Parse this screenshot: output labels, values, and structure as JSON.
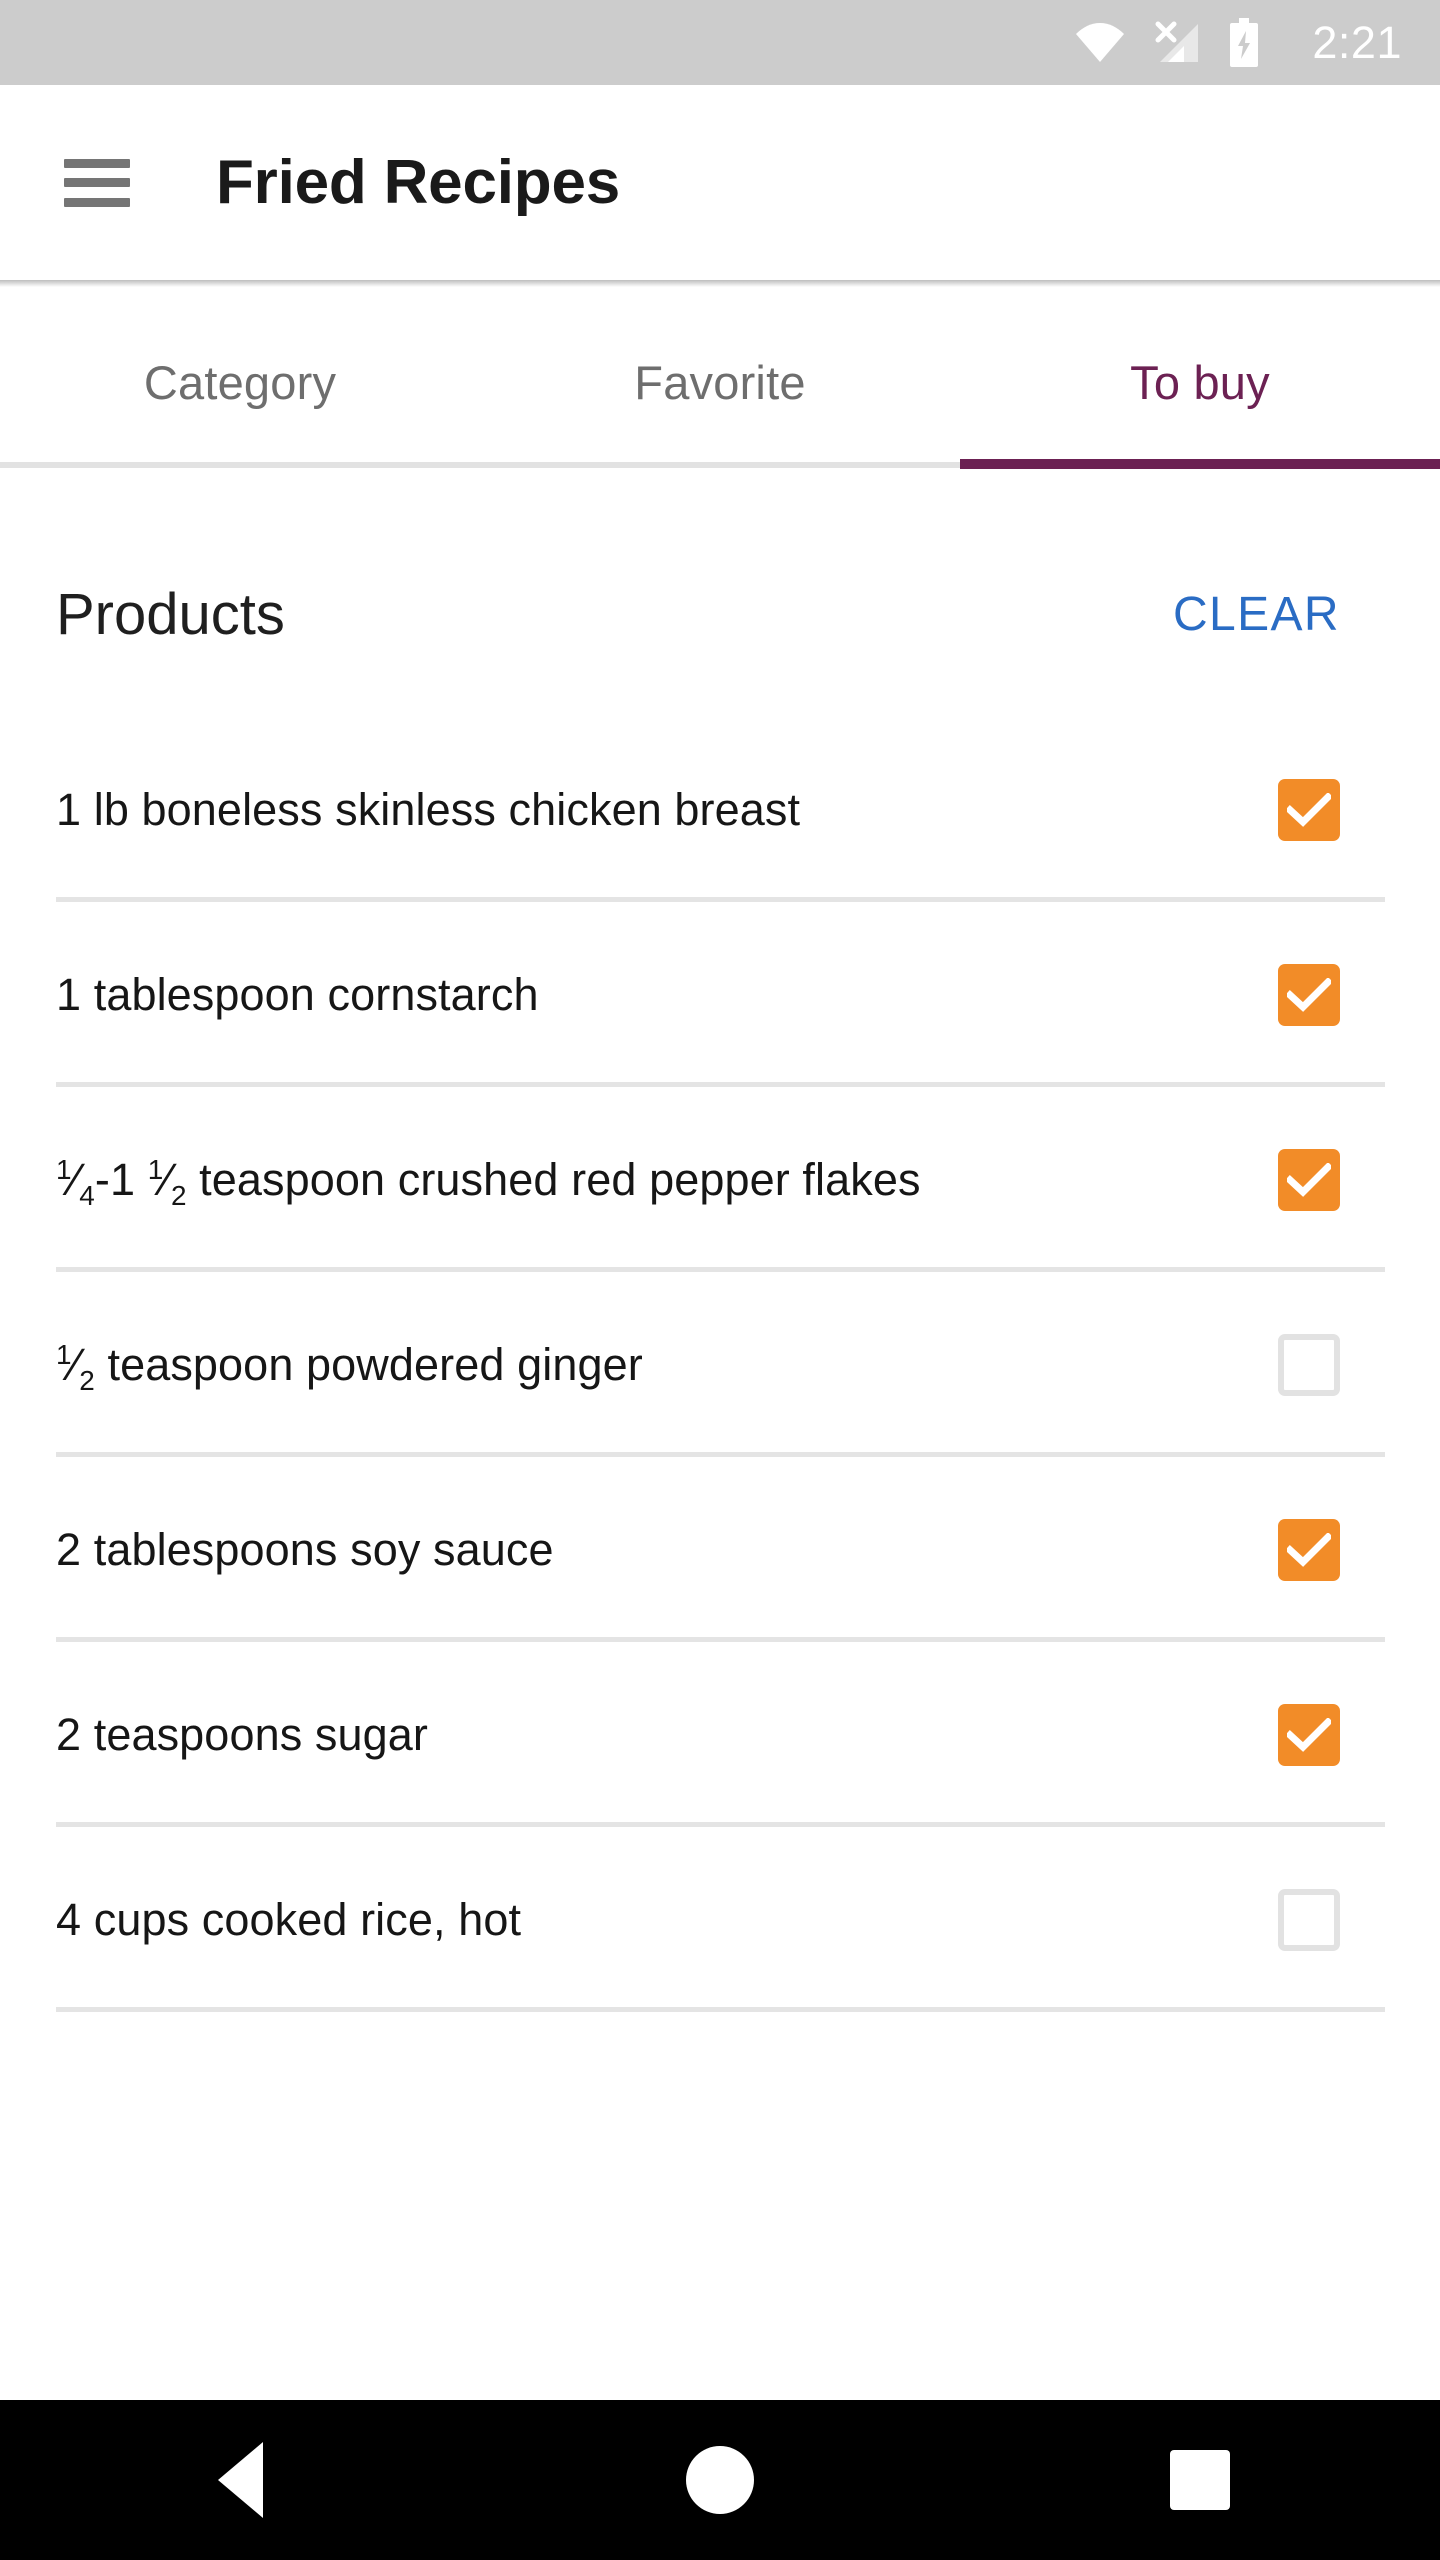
{
  "status_bar": {
    "time": "2:21",
    "icons": [
      "wifi-icon",
      "cellular-no-sim-icon",
      "battery-charging-icon"
    ],
    "background_color": "#cccccc"
  },
  "app_bar": {
    "menu_icon": "hamburger-menu-icon",
    "title": "Fried Recipes"
  },
  "tabs": {
    "active_index": 2,
    "active_color": "#6c2153",
    "inactive_color": "#6e6e6e",
    "items": [
      {
        "label": "Category"
      },
      {
        "label": "Favorite"
      },
      {
        "label": "To buy"
      }
    ]
  },
  "section": {
    "title": "Products",
    "clear_label": "CLEAR",
    "clear_color": "#2a6cc4"
  },
  "checkbox": {
    "checked_color": "#f28c28",
    "unchecked_border_color": "#e2e2e2",
    "check_icon": "check-mark-icon"
  },
  "products": [
    {
      "label": "1 lb boneless skinless chicken breast",
      "label_html": "1 lb boneless skinless chicken breast",
      "checked": true
    },
    {
      "label": "1 tablespoon cornstarch",
      "label_html": "1 tablespoon cornstarch",
      "checked": true
    },
    {
      "label": "¼-1 ½ teaspoon crushed red pepper flakes",
      "label_html": "<sup>1</sup>⁄<sub>4</sub>-1 <sup>1</sup>⁄<sub>2</sub> teaspoon crushed red pepper flakes",
      "checked": true
    },
    {
      "label": "½ teaspoon powdered ginger",
      "label_html": "<sup>1</sup>⁄<sub>2</sub> teaspoon powdered ginger",
      "checked": false
    },
    {
      "label": "2 tablespoons soy sauce",
      "label_html": "2 tablespoons soy sauce",
      "checked": true
    },
    {
      "label": "2 teaspoons sugar",
      "label_html": "2 teaspoons sugar",
      "checked": true
    },
    {
      "label": "4 cups cooked rice, hot",
      "label_html": "4 cups cooked rice, hot",
      "checked": false
    }
  ],
  "nav_bar": {
    "background_color": "#000000",
    "buttons": [
      {
        "name": "back-button",
        "icon": "triangle-left-icon"
      },
      {
        "name": "home-button",
        "icon": "circle-icon"
      },
      {
        "name": "recents-button",
        "icon": "square-icon"
      }
    ]
  }
}
